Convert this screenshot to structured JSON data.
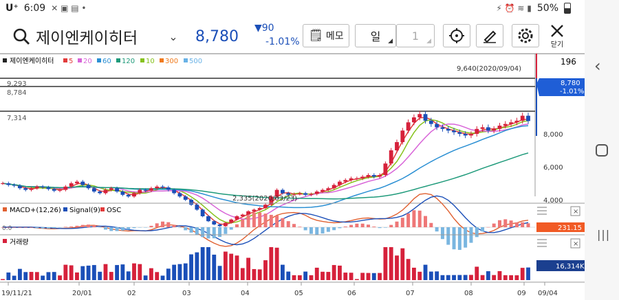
{
  "status": {
    "carrier": "U⁺",
    "time": "6:09",
    "battery": "50%"
  },
  "header": {
    "stock_name": "제이엔케이히터",
    "price": "8,780",
    "change": "▼90",
    "change_pct": "-1.01%",
    "memo_label": "메모",
    "period_label": "일",
    "period_count": "1",
    "close_label": "닫기"
  },
  "colors": {
    "up": "#d6213b",
    "down": "#1b4fb8",
    "ma5": "#e23b3b",
    "ma20": "#d864d8",
    "ma60": "#2a8fd3",
    "ma120": "#1e9a7a",
    "ma10": "#86c21c",
    "ma300": "#f07a1c",
    "ma500": "#69b2e6"
  },
  "legend": {
    "name": "제이엔케이히터",
    "items": [
      {
        "label": "5",
        "color": "#e23b3b"
      },
      {
        "label": "20",
        "color": "#d864d8"
      },
      {
        "label": "60",
        "color": "#2a8fd3"
      },
      {
        "label": "120",
        "color": "#1e9a7a"
      },
      {
        "label": "10",
        "color": "#86c21c"
      },
      {
        "label": "300",
        "color": "#f07a1c"
      },
      {
        "label": "500",
        "color": "#69b2e6"
      }
    ]
  },
  "chart_data": [
    {
      "type": "candlestick",
      "x": [
        "19/11/21",
        "20/01",
        "02",
        "03",
        "04",
        "05",
        "06",
        "07",
        "08",
        "09",
        "09/04"
      ],
      "y_ticks": [
        "8,000",
        "6,000",
        "4,000"
      ],
      "ylim": [
        2000,
        10000
      ],
      "levels": [
        "9,293",
        "8,784",
        "7,314"
      ],
      "high_annotation": "9,640(2020/09/04)",
      "low_annotation": "2,335(2020/03/23)",
      "top_value": "196",
      "last_price": "8,780",
      "last_change": "-1.01%",
      "closes": [
        5000,
        4900,
        4850,
        4700,
        4600,
        4700,
        4800,
        4750,
        4650,
        4550,
        4600,
        4800,
        5000,
        5100,
        4900,
        4700,
        4500,
        4400,
        4600,
        4700,
        4500,
        4300,
        4200,
        4400,
        4600,
        4550,
        4700,
        4800,
        4750,
        4600,
        4400,
        4200,
        4000,
        3700,
        3400,
        3000,
        2700,
        2500,
        2400,
        2600,
        2800,
        3000,
        3100,
        3300,
        3400,
        3500,
        3700,
        4200,
        4600,
        4400,
        4300,
        4350,
        4400,
        4300,
        4350,
        4500,
        4600,
        4700,
        4900,
        5100,
        5200,
        5300,
        5300,
        5400,
        5500,
        5400,
        5500,
        6200,
        7000,
        7500,
        8200,
        8700,
        9000,
        9200,
        8800,
        8600,
        8400,
        8300,
        8200,
        8100,
        8000,
        7900,
        8000,
        8300,
        8400,
        8200,
        8300,
        8500,
        8600,
        8700,
        8800,
        9100,
        8780
      ]
    },
    {
      "type": "line",
      "title": "MACD+(12,26)",
      "series": [
        {
          "name": "Signal(9)"
        },
        {
          "name": "OSC"
        }
      ],
      "axis_value": "0.0",
      "last_value": "231.15"
    },
    {
      "type": "bar",
      "title": "거래량",
      "last_value": "16,314K"
    }
  ]
}
